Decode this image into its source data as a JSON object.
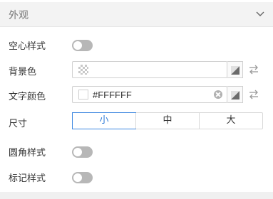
{
  "section": {
    "title": "外观",
    "collapse_icon": "chevron-down-icon"
  },
  "hollow_style": {
    "label": "空心样式",
    "enabled": false
  },
  "background_color": {
    "label": "背景色",
    "value": ""
  },
  "text_color": {
    "label": "文字颜色",
    "value": "#FFFFFF"
  },
  "size": {
    "label": "尺寸",
    "options": [
      "小",
      "中",
      "大"
    ],
    "selected": "小"
  },
  "rounded_style": {
    "label": "圆角样式",
    "enabled": false
  },
  "marker_style": {
    "label": "标记样式",
    "enabled": false
  },
  "colors": {
    "accent": "#2f7bd8",
    "toggle_off": "#b7b7b7",
    "header_bg": "#f3f3f3"
  }
}
